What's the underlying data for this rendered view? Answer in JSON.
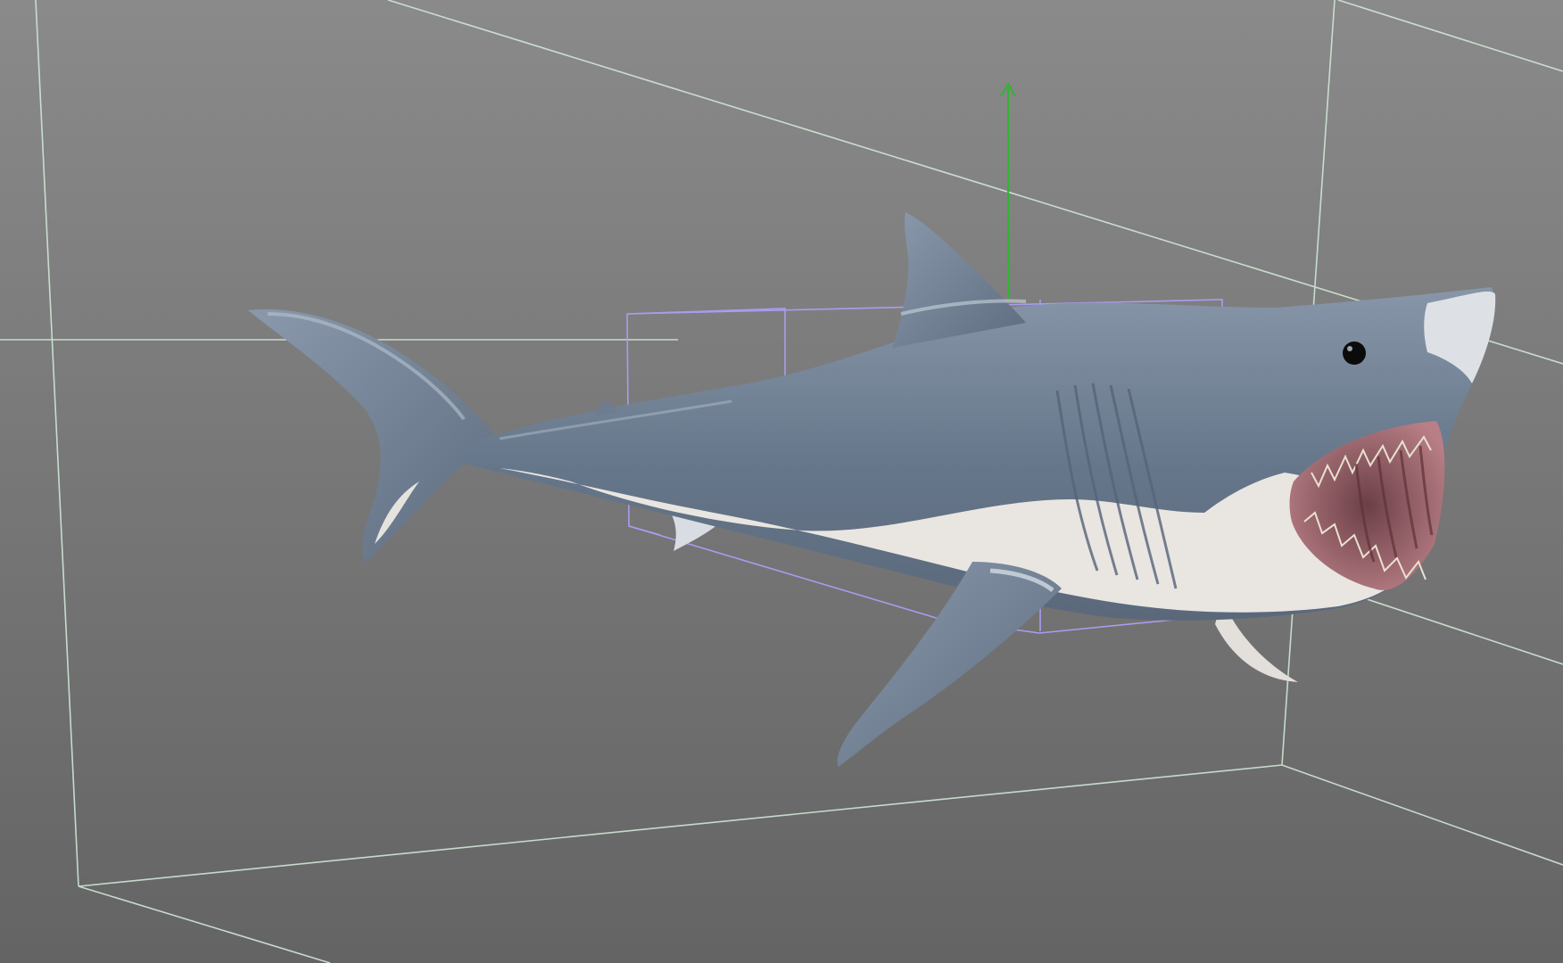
{
  "viewport": {
    "background_top": "#8a8a8a",
    "background_bottom": "#646464",
    "grid_line_color": "#cfe8d6",
    "selection_box_color": "#a99cf0",
    "gizmo_y_axis_color": "#2fb52f",
    "gizmo_x_axis_color": "#d22a2a"
  },
  "scene_object": {
    "name_icon": "shark-model",
    "body_color": "#6f7f93",
    "belly_color": "#e9e6e2",
    "mouth_color": "#8d5a62"
  }
}
